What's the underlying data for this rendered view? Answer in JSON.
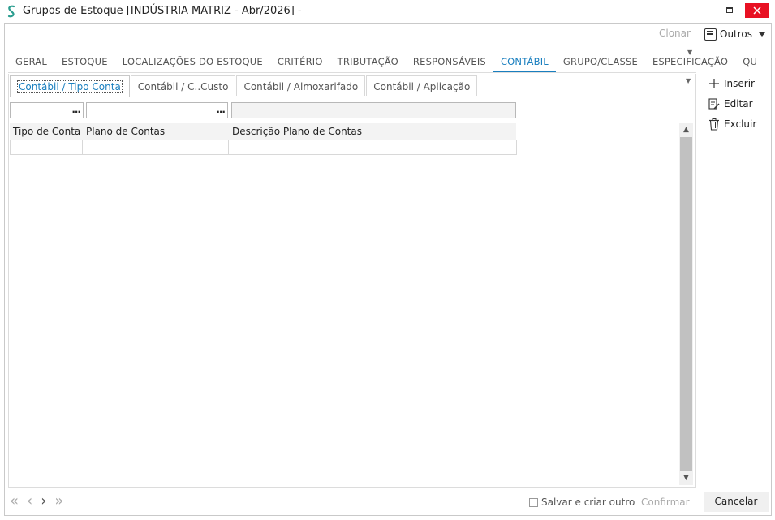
{
  "window": {
    "title": "Grupos de Estoque [INDÚSTRIA MATRIZ - Abr/2026]  -",
    "colors": {
      "accent": "#1a7fbf",
      "close": "#e81123",
      "app_icon": "#2a9d8f"
    }
  },
  "toolbar": {
    "clonar_label": "Clonar",
    "outros_label": "Outros"
  },
  "main_tabs": [
    {
      "label": "GERAL"
    },
    {
      "label": "ESTOQUE"
    },
    {
      "label": "LOCALIZAÇÕES DO ESTOQUE"
    },
    {
      "label": "CRITÉRIO"
    },
    {
      "label": "TRIBUTAÇÃO"
    },
    {
      "label": "RESPONSÁVEIS"
    },
    {
      "label": "CONTÁBIL",
      "active": true
    },
    {
      "label": "GRUPO/CLASSE"
    },
    {
      "label": "ESPECIFICAÇÃO"
    },
    {
      "label": "QU"
    }
  ],
  "sub_tabs": [
    {
      "label": "Contábil / Tipo Conta",
      "active": true
    },
    {
      "label": "Contábil / C..Custo"
    },
    {
      "label": "Contábil / Almoxarifado"
    },
    {
      "label": "Contábil / Aplicação"
    }
  ],
  "filters": {
    "tipo_conta": "",
    "plano_contas": "",
    "descricao": "",
    "lookup_button": "..."
  },
  "grid": {
    "columns": [
      "Tipo de Conta",
      "Plano de Contas",
      "Descrição Plano de Contas"
    ],
    "rows": [
      [
        "",
        "",
        ""
      ]
    ]
  },
  "actions": {
    "inserir": "Inserir",
    "editar": "Editar",
    "excluir": "Excluir"
  },
  "footer": {
    "salvar_criar_outro": "Salvar e criar outro",
    "confirmar": "Confirmar",
    "cancelar": "Cancelar"
  }
}
